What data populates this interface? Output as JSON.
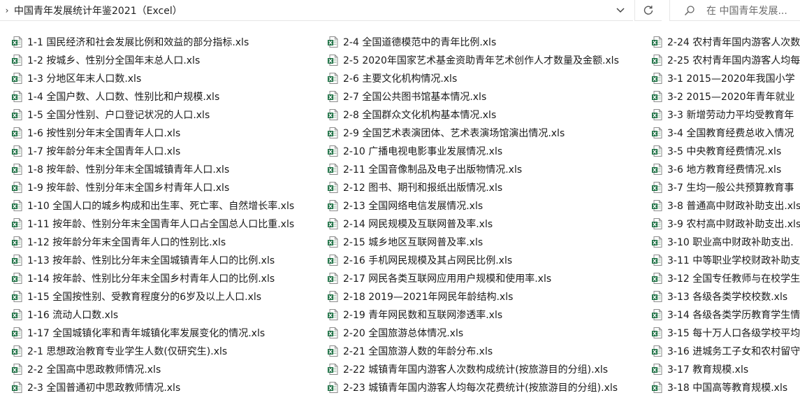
{
  "address_bar": {
    "path": "中国青年发展统计年鉴2021（Excel）"
  },
  "search": {
    "placeholder": "在 中国青年发展..."
  },
  "files": {
    "col1": [
      "1-1 国民经济和社会发展比例和效益的部分指标.xls",
      "1-2 按城乡、性别分全国年末总人口.xls",
      "1-3 分地区年末人口数.xls",
      "1-4 全国户数、人口数、性别比和户规模.xls",
      "1-5 全国分性别、户口登记状况的人口.xls",
      "1-6 按性别分年末全国青年人口.xls",
      "1-7 按年龄分年末全国青年人口.xls",
      "1-8 按年龄、性别分年末全国城镇青年人口.xls",
      "1-9 按年龄、性别分年末全国乡村青年人口.xls",
      "1-10 全国人口的城乡构成和出生率、死亡率、自然增长率.xls",
      "1-11 按年龄、性别分年末全国青年人口占全国总人口比重.xls",
      "1-12 按年龄分年末全国青年人口的性别比.xls",
      "1-13 按年龄、性别比分年末全国城镇青年人口的比例.xls",
      "1-14 按年龄、性别比分年末全国乡村青年人口的比例.xls",
      "1-15 全国按性别、受教育程度分的6岁及以上人口.xls",
      "1-16 流动人口数.xls",
      "1-17 全国城镇化率和青年城镇化率发展变化的情况.xls",
      "2-1 思想政治教育专业学生人数(仅研究生).xls",
      "2-2 全国高中思政教师情况.xls",
      "2-3 全国普通初中思政教师情况.xls"
    ],
    "col2": [
      "2-4 全国道德模范中的青年比例.xls",
      "2-5 2020年国家艺术基金资助青年艺术创作人才数量及金额.xls",
      "2-6 主要文化机构情况.xls",
      "2-7 全国公共图书馆基本情况.xls",
      "2-8 全国群众文化机构基本情况.xls",
      "2-9 全国艺术表演团体、艺术表演场馆演出情况.xls",
      "2-10 广播电视电影事业发展情况.xls",
      "2-11 全国音像制品及电子出版物情况.xls",
      "2-12 图书、期刊和报纸出版情况.xls",
      "2-13 全国网络电信发展情况.xls",
      "2-14 网民规模及互联网普及率.xls",
      "2-15 城乡地区互联网普及率.xls",
      "2-16 手机网民规模及其占网民比例.xls",
      "2-17 网民各类互联网应用用户规模和使用率.xls",
      "2-18 2019—2021年网民年龄结构.xls",
      "2-19 青年网民数和互联网渗透率.xls",
      "2-20 全国旅游总体情况.xls",
      "2-21 全国旅游人数的年龄分布.xls",
      "2-22 城镇青年国内游客人次数构成统计(按旅游目的分组).xls",
      "2-23 城镇青年国内游客人均每次花费统计(按旅游目的分组).xls"
    ],
    "col3": [
      "2-24 农村青年国内游客人次数",
      "2-25 农村青年国内游客人均每",
      "3-1 2015—2020年我国小学",
      "3-2 2015—2020年青年就业",
      "3-3 新增劳动力平均受教育年",
      "3-4 全国教育经费总收入情况",
      "3-5 中央教育经费情况.xls",
      "3-6 地方教育经费情况.xls",
      "3-7 生均一般公共预算教育事",
      "3-8 普通高中财政补助支出.xls",
      "3-9 农村高中财政补助支出.xls",
      "3-10 职业高中财政补助支出.",
      "3-11 中等职业学校财政补助支",
      "3-12 全国专任教师与在校学生",
      "3-13 各级各类学校校数.xls",
      "3-14 各级各类学历教育学生情",
      "3-15 每十万人口各级学校平均",
      "3-16 进城务工子女和农村留守",
      "3-17 教育规模.xls",
      "3-18 中国高等教育规模.xls"
    ]
  },
  "colors": {
    "excel_green": "#1e7145",
    "text": "#1a1a1a",
    "divider": "#e6e6e6"
  }
}
